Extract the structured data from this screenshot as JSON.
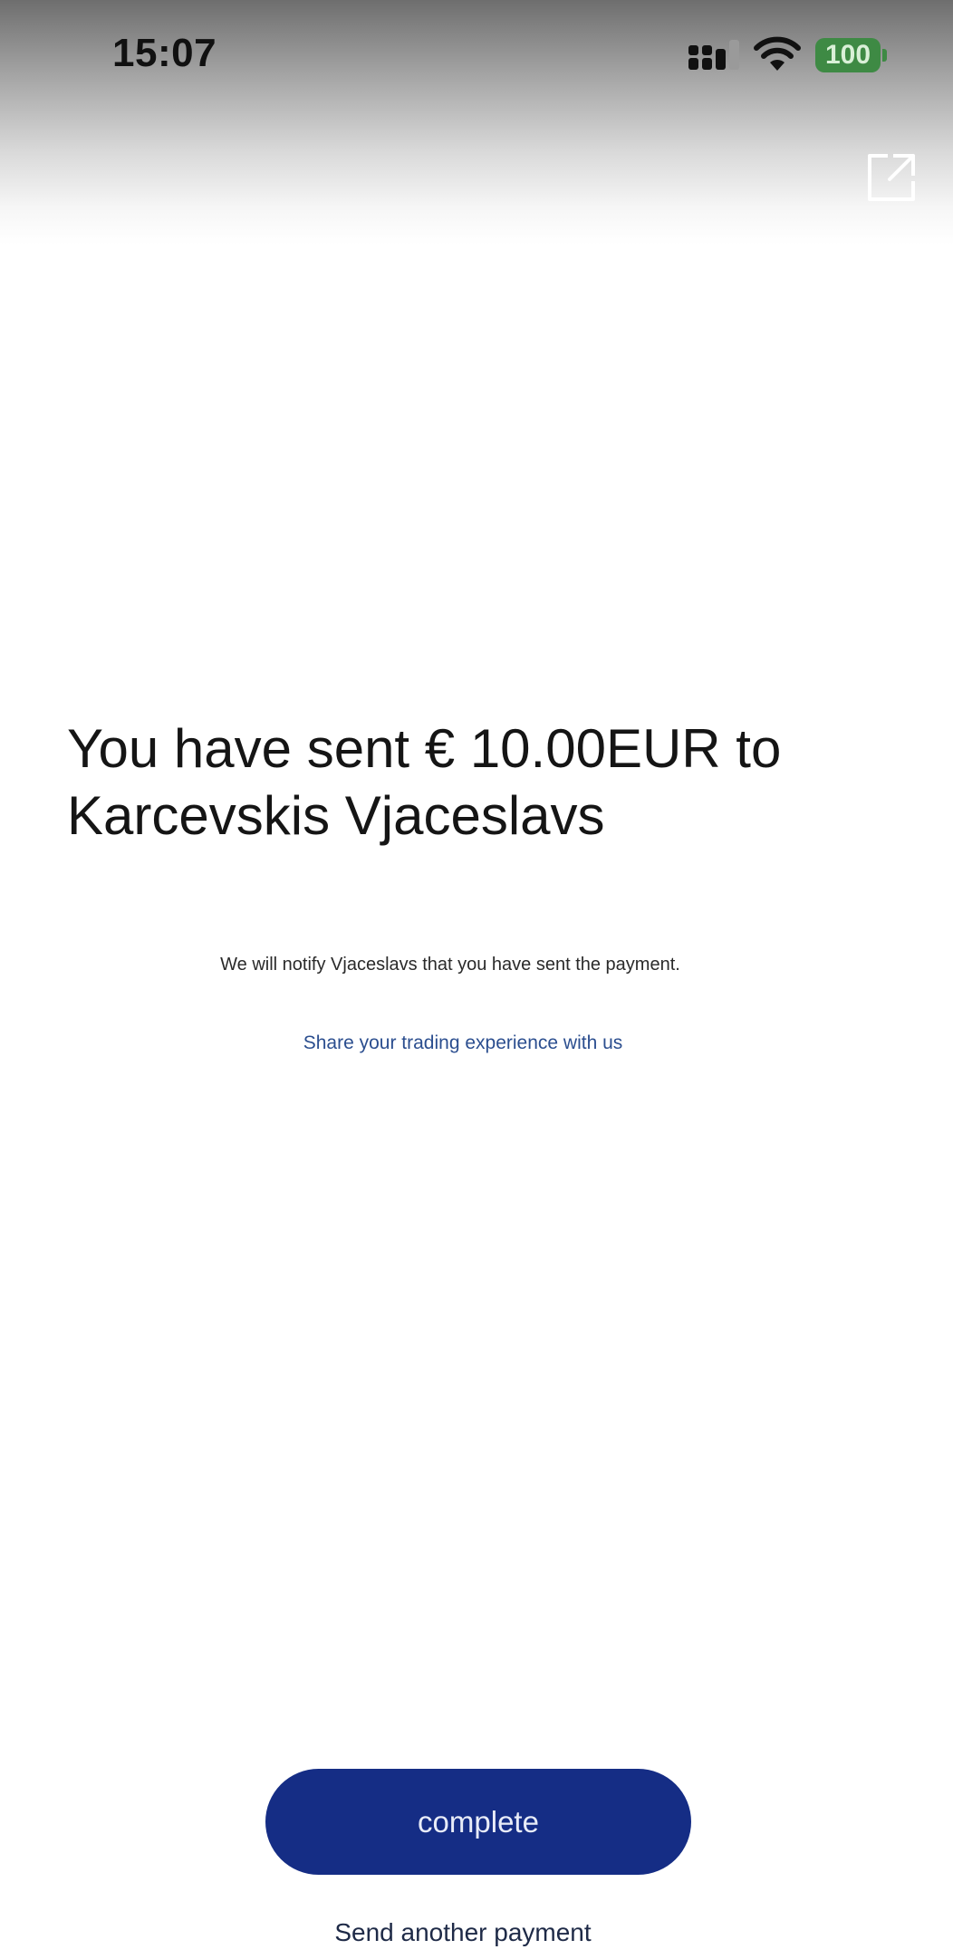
{
  "status_bar": {
    "time": "15:07",
    "battery_level": "100",
    "signal_icon": "cellular-signal-icon",
    "wifi_icon": "wifi-icon",
    "battery_color": "#3e8a44"
  },
  "header": {
    "share_icon": "external-share-icon"
  },
  "confirmation": {
    "headline": "You have sent € 10.00EUR to Karcevskis Vjaceslavs",
    "notify_text": "We will notify Vjaceslavs that you have sent the payment.",
    "share_link": "Share your trading experience with us"
  },
  "actions": {
    "complete_label": "complete",
    "send_another_label": "Send another payment",
    "primary_color": "#152d85"
  }
}
